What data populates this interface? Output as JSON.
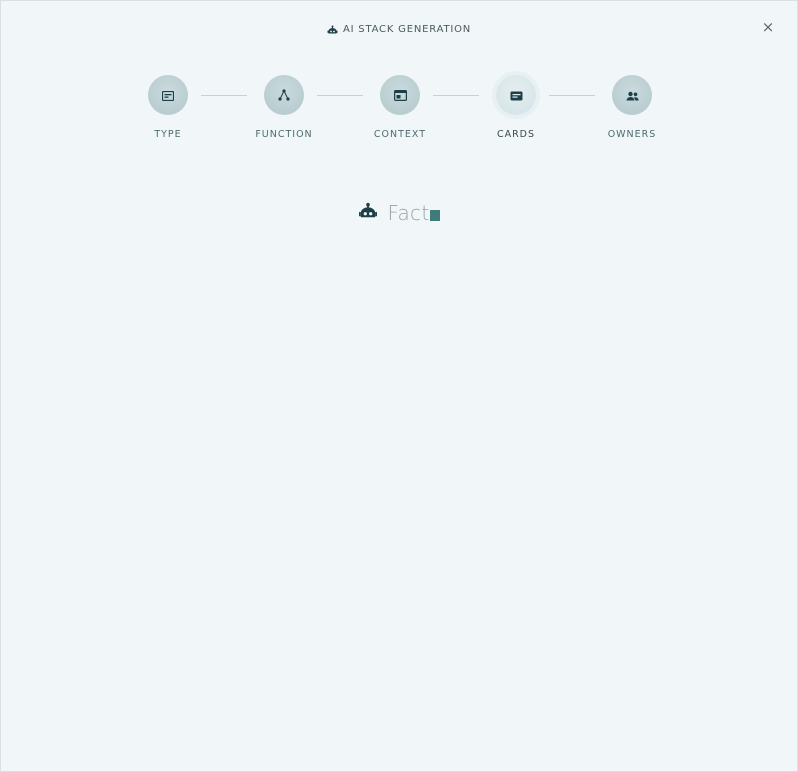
{
  "header": {
    "icon": "robot-icon",
    "title": "AI STACK GENERATION",
    "close_icon": "close-icon",
    "close_label": "×"
  },
  "stepper": {
    "active_step": "CARDS",
    "steps": [
      {
        "label": "TYPE",
        "icon": "type-icon"
      },
      {
        "label": "FUNCTION",
        "icon": "function-icon"
      },
      {
        "label": "CONTEXT",
        "icon": "context-icon"
      },
      {
        "label": "CARDS",
        "icon": "cards-icon"
      },
      {
        "label": "OWNERS",
        "icon": "owners-icon"
      }
    ]
  },
  "typing": {
    "icon": "robot-icon",
    "text": "Fact"
  },
  "colors": {
    "background": "#f1f6f8",
    "icon_dark": "#1f3f48",
    "accent": "#3f7b78",
    "step_circle": "#b2c8cc",
    "label": "#4e6b70"
  }
}
